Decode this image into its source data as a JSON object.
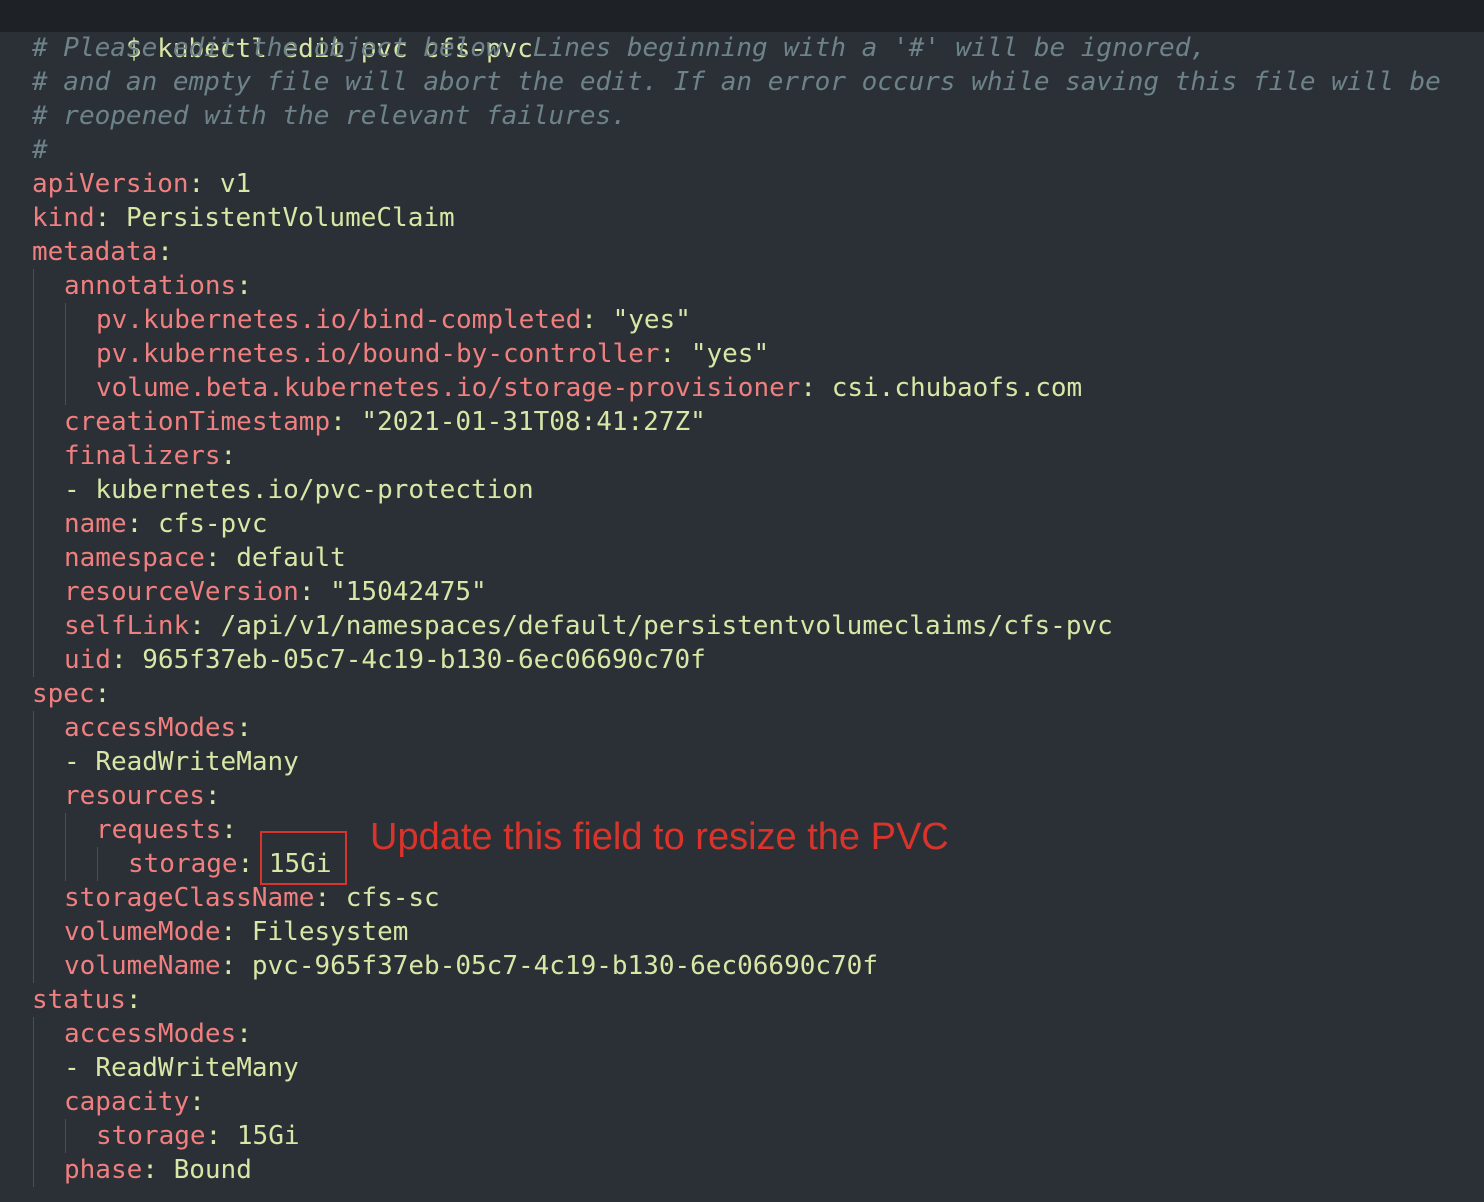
{
  "terminal": {
    "prompt": "$",
    "command": "kubectl edit pvc cfs-pvc"
  },
  "comments": [
    "# Please edit the object below. Lines beginning with a '#' will be ignored,",
    "# and an empty file will abort the edit. If an error occurs while saving this file will be",
    "# reopened with the relevant failures.",
    "#"
  ],
  "yaml": {
    "apiVersion": {
      "key": "apiVersion",
      "value": "v1"
    },
    "kind": {
      "key": "kind",
      "value": "PersistentVolumeClaim"
    },
    "metadata": {
      "key": "metadata",
      "annotations": {
        "key": "annotations",
        "items": [
          {
            "key": "pv.kubernetes.io/bind-completed",
            "value": "\"yes\""
          },
          {
            "key": "pv.kubernetes.io/bound-by-controller",
            "value": "\"yes\""
          },
          {
            "key": "volume.beta.kubernetes.io/storage-provisioner",
            "value": "csi.chubaofs.com"
          }
        ]
      },
      "creationTimestamp": {
        "key": "creationTimestamp",
        "value": "\"2021-01-31T08:41:27Z\""
      },
      "finalizers": {
        "key": "finalizers",
        "items": [
          "kubernetes.io/pvc-protection"
        ]
      },
      "name": {
        "key": "name",
        "value": "cfs-pvc"
      },
      "namespace": {
        "key": "namespace",
        "value": "default"
      },
      "resourceVersion": {
        "key": "resourceVersion",
        "value": "\"15042475\""
      },
      "selfLink": {
        "key": "selfLink",
        "value": "/api/v1/namespaces/default/persistentvolumeclaims/cfs-pvc"
      },
      "uid": {
        "key": "uid",
        "value": "965f37eb-05c7-4c19-b130-6ec06690c70f"
      }
    },
    "spec": {
      "key": "spec",
      "accessModes": {
        "key": "accessModes",
        "items": [
          "ReadWriteMany"
        ]
      },
      "resources": {
        "key": "resources",
        "requests": {
          "key": "requests",
          "storage": {
            "key": "storage",
            "value": "15Gi"
          }
        }
      },
      "storageClassName": {
        "key": "storageClassName",
        "value": "cfs-sc"
      },
      "volumeMode": {
        "key": "volumeMode",
        "value": "Filesystem"
      },
      "volumeName": {
        "key": "volumeName",
        "value": "pvc-965f37eb-05c7-4c19-b130-6ec06690c70f"
      }
    },
    "status": {
      "key": "status",
      "accessModes": {
        "key": "accessModes",
        "items": [
          "ReadWriteMany"
        ]
      },
      "capacity": {
        "key": "capacity",
        "storage": {
          "key": "storage",
          "value": "15Gi"
        }
      },
      "phase": {
        "key": "phase",
        "value": "Bound"
      }
    }
  },
  "annotation": {
    "text": "Update this field to resize the PVC",
    "color": "#d9342b"
  },
  "colors": {
    "background": "#2b3036",
    "command_bar": "#1e2227",
    "key": "#f07f7f",
    "value": "#d8e6a6",
    "comment": "#6d8289"
  }
}
